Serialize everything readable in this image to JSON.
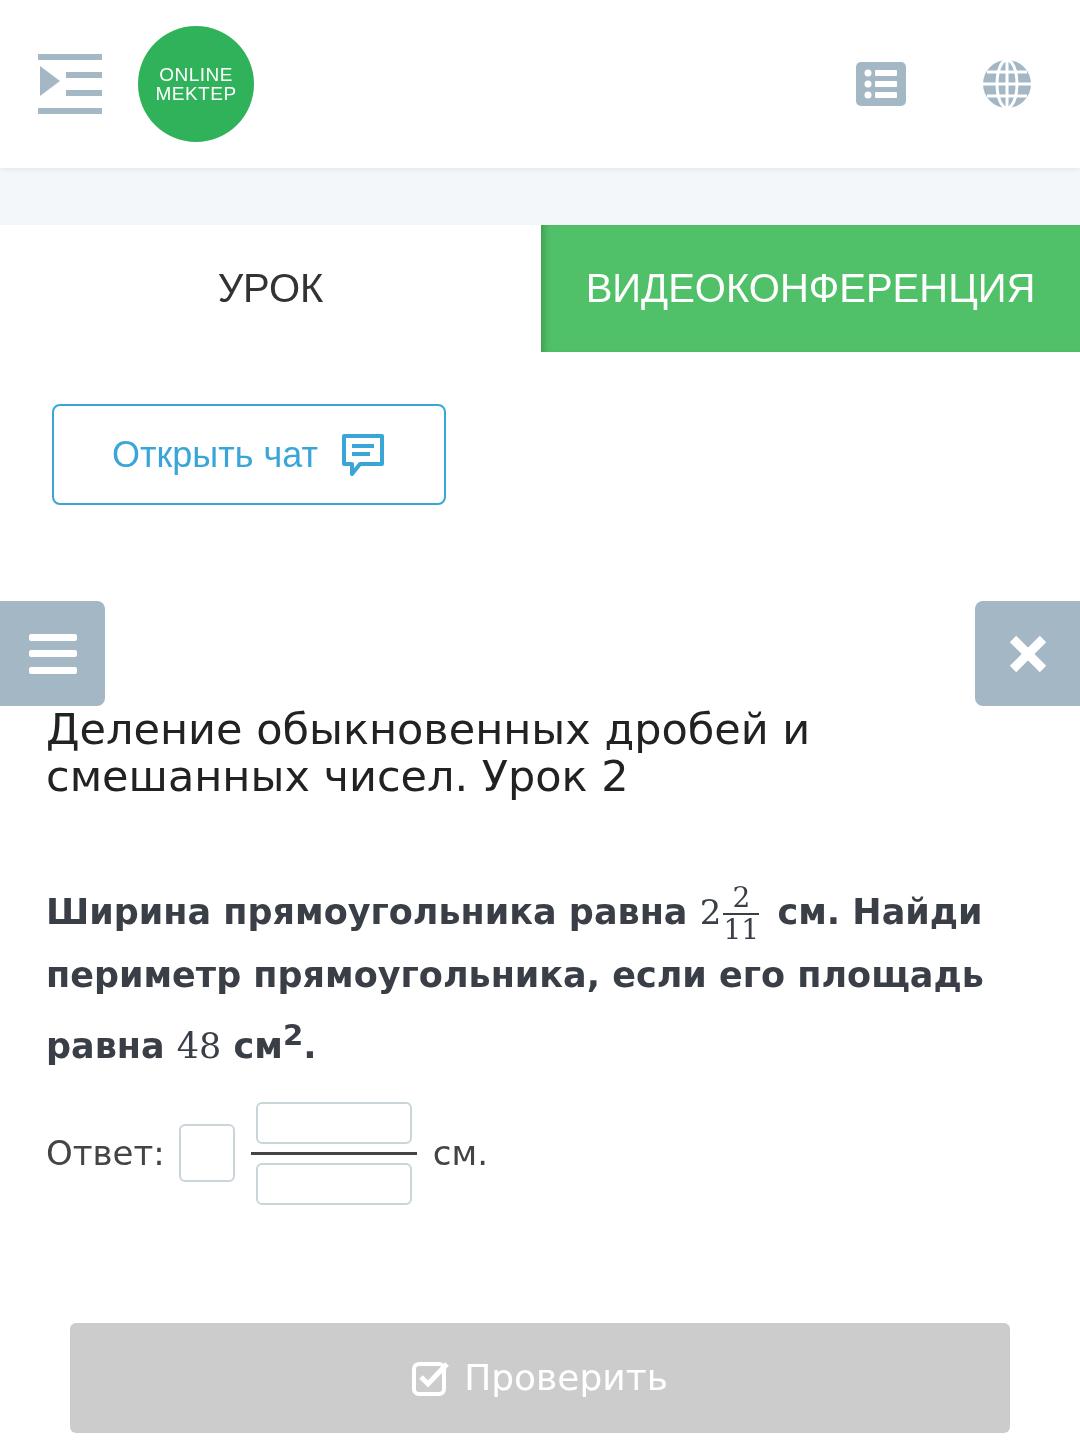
{
  "header": {
    "logo_line_1": "ONLINE",
    "logo_line_2": "MEKTEP"
  },
  "tabs": [
    {
      "label": "УРОК",
      "selected": true
    },
    {
      "label": "ВИДЕОКОНФЕРЕНЦИЯ",
      "selected": false
    }
  ],
  "chat_button": {
    "label": "Открыть чат"
  },
  "task": {
    "title": "Деление обыкновенных дробей и смешанных чисел. Урок 2",
    "question": {
      "before": "Ширина прямоугольника равна",
      "whole": "2",
      "numerator": "2",
      "denominator": "11",
      "after_1": "см. Найди периметр прямоугольника, если его площадь равна",
      "area": "48",
      "after_2": "см$^{2}$."
    },
    "answer": {
      "label": "Ответ:",
      "unit": "см."
    }
  },
  "check_button": {
    "label": "Проверить",
    "disabled": true
  }
}
